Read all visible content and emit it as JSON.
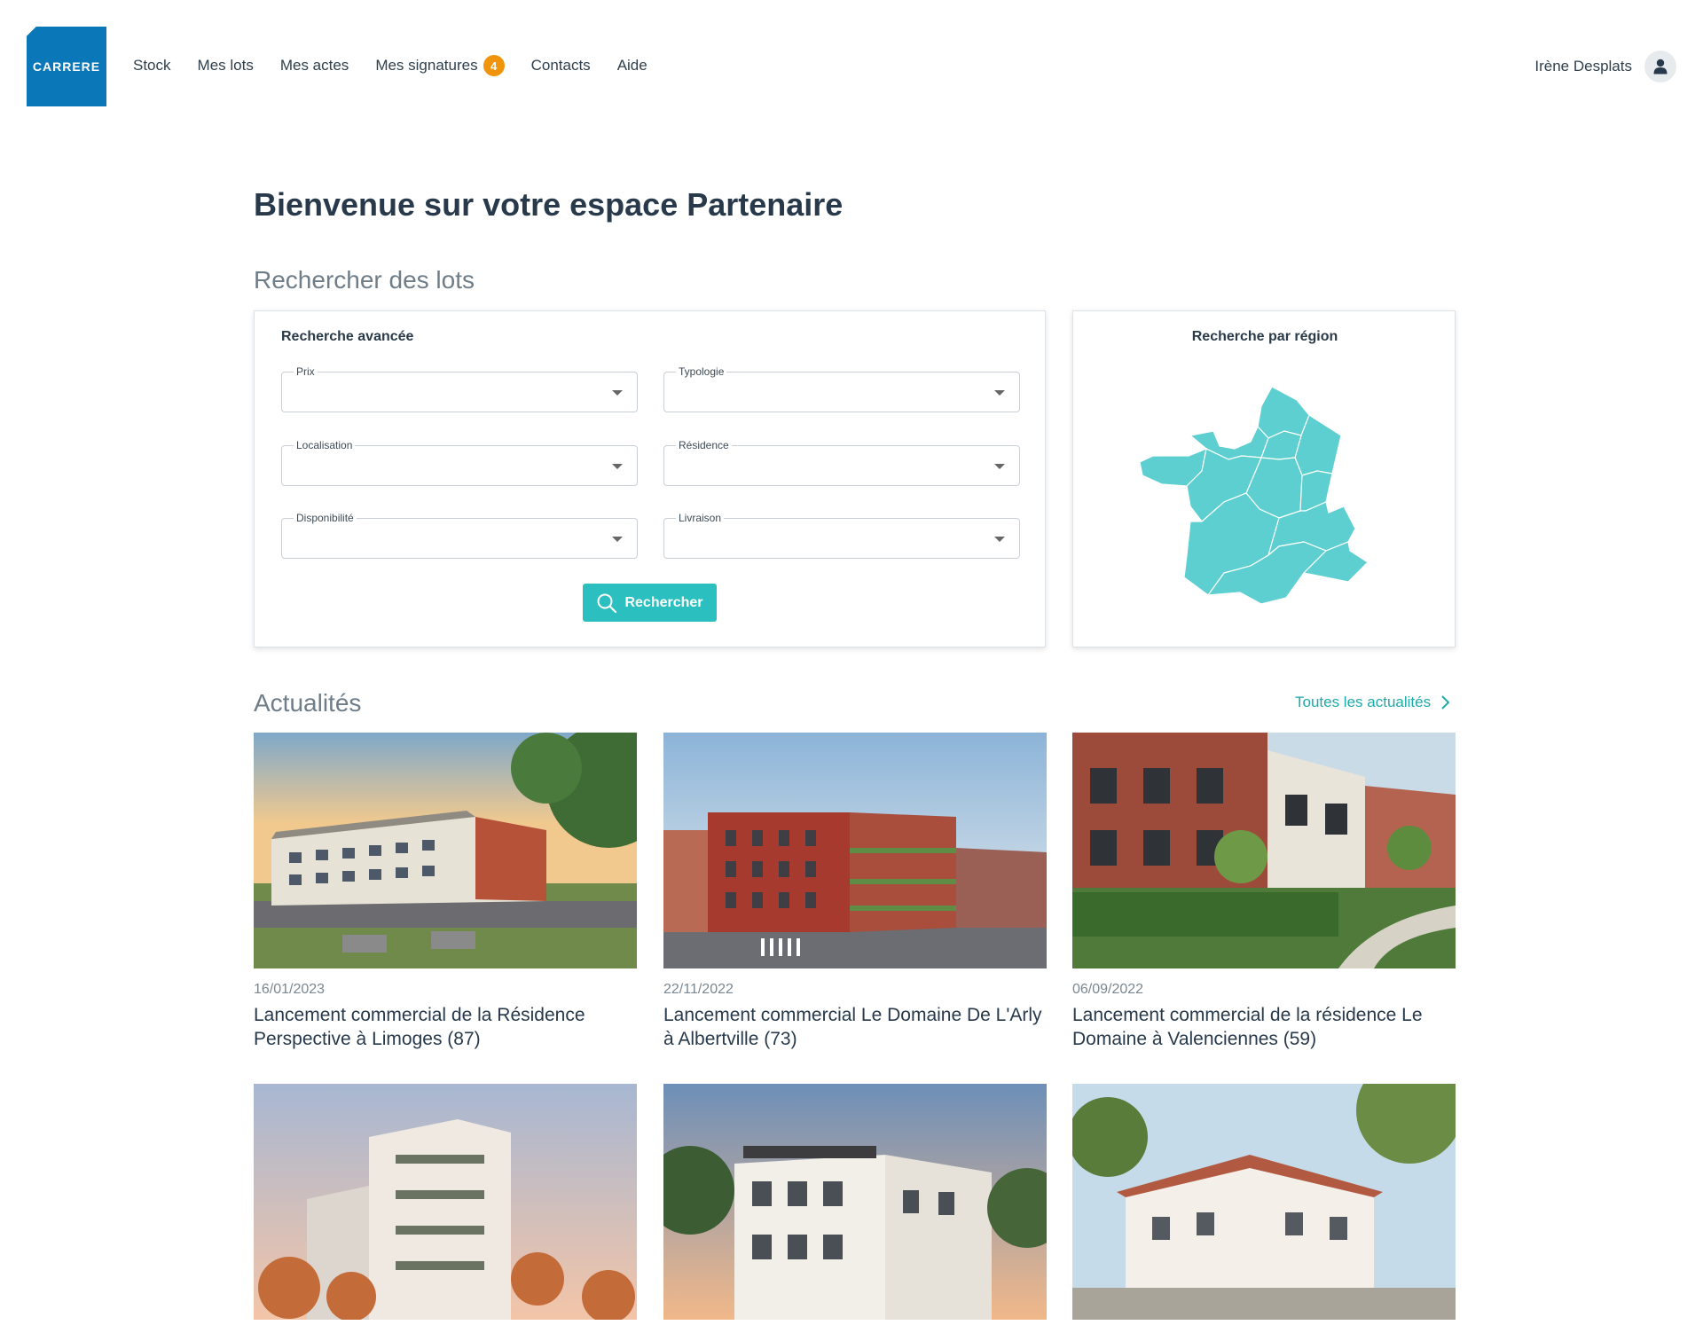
{
  "header": {
    "logo_text": "CARRERE",
    "nav": [
      {
        "label": "Stock"
      },
      {
        "label": "Mes lots"
      },
      {
        "label": "Mes actes"
      },
      {
        "label": "Mes signatures",
        "badge": "4"
      },
      {
        "label": "Contacts"
      },
      {
        "label": "Aide"
      }
    ],
    "user_name": "Irène Desplats",
    "avatar_icon": "user-icon"
  },
  "page_title": "Bienvenue sur votre espace Partenaire",
  "search_section": {
    "title": "Rechercher des lots",
    "advanced": {
      "title": "Recherche avancée",
      "fields": [
        {
          "label": "Prix",
          "value": ""
        },
        {
          "label": "Typologie",
          "value": ""
        },
        {
          "label": "Localisation",
          "value": ""
        },
        {
          "label": "Résidence",
          "value": ""
        },
        {
          "label": "Disponibilité",
          "value": ""
        },
        {
          "label": "Livraison",
          "value": ""
        }
      ],
      "button_label": "Rechercher"
    },
    "region": {
      "title": "Recherche par région",
      "map_color": "#5ecfd0"
    }
  },
  "news_section": {
    "title": "Actualités",
    "all_link": "Toutes les actualités",
    "items": [
      {
        "date": "16/01/2023",
        "title": "Lancement commercial de la Résidence Perspective à Limoges (87)"
      },
      {
        "date": "22/11/2022",
        "title": "Lancement commercial Le Domaine De L'Arly à Albertville (73)"
      },
      {
        "date": "06/09/2022",
        "title": "Lancement commercial de la résidence Le Domaine à Valenciennes (59)"
      },
      {
        "date": "",
        "title": ""
      },
      {
        "date": "",
        "title": ""
      },
      {
        "date": "",
        "title": ""
      }
    ]
  },
  "colors": {
    "brand": "#0a77b8",
    "accent": "#2bbfbf",
    "badge": "#f0950b"
  }
}
